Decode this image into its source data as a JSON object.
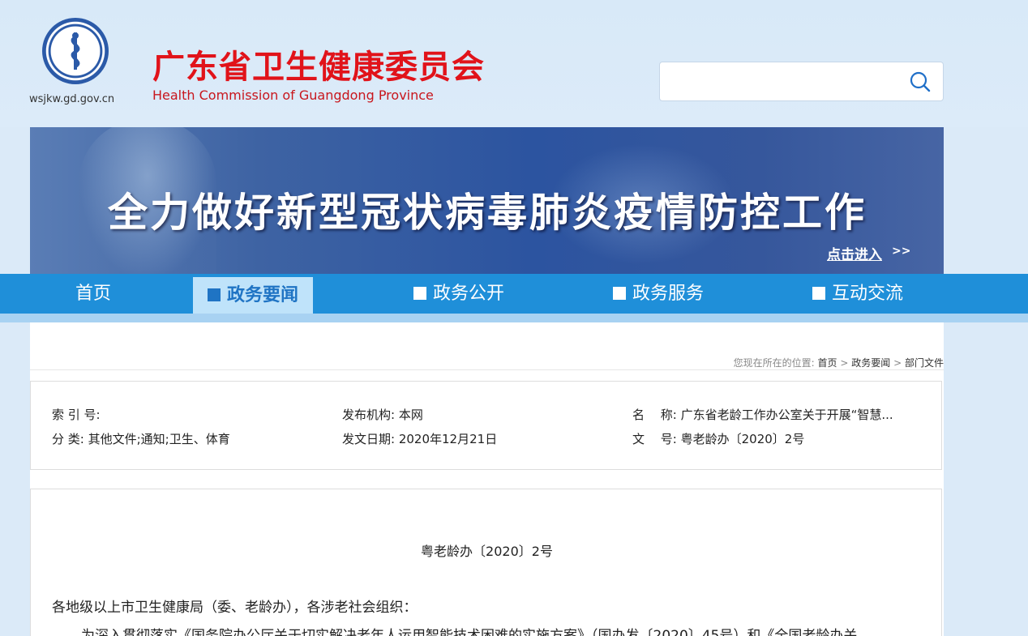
{
  "header": {
    "site_url": "wsjkw.gd.gov.cn",
    "title": "广东省卫生健康委员会",
    "subtitle": "Health Commission of Guangdong Province",
    "search_placeholder": ""
  },
  "banner": {
    "headline": "全力做好新型冠状病毒肺炎疫情防控工作",
    "link": "点击进入",
    "arrows": ">>"
  },
  "nav": {
    "items": [
      {
        "label": "首页",
        "icon": "home"
      },
      {
        "label": "政务要闻",
        "icon": "news-icon"
      },
      {
        "label": "政务公开",
        "icon": "book-icon"
      },
      {
        "label": "政务服务",
        "icon": "document-icon"
      },
      {
        "label": "互动交流",
        "icon": "chat-icon"
      }
    ],
    "active_index": 1
  },
  "breadcrumb": {
    "prefix": "您现在所在的位置:",
    "items": [
      "首页",
      "政务要闻",
      "部门文件"
    ],
    "sep": ">"
  },
  "meta": {
    "index_label": "索 引 号:",
    "index_value": "",
    "category_label": "分 类:",
    "category_value": "其他文件;通知;卫生、体育",
    "publisher_label": "发布机构:",
    "publisher_value": "本网",
    "date_label": "发文日期:",
    "date_value": "2020年12月21日",
    "name_label": "名　 称:",
    "name_value": "广东省老龄工作办公室关于开展“智慧...",
    "docnum_label": "文　 号:",
    "docnum_value": "粤老龄办〔2020〕2号"
  },
  "document": {
    "number": "粤老龄办〔2020〕2号",
    "salutation": "各地级以上市卫生健康局（委、老龄办），各涉老社会组织：",
    "para1": "为深入贯彻落实《国务院办公厅关于切实解决老年人运用智能技术困难的实施方案》（国办发〔2020〕45号）和《全国老龄办关"
  },
  "colors": {
    "title_red": "#e1131a",
    "nav_blue": "#1f8fd9",
    "nav_active_bg": "#bfe3fa"
  }
}
